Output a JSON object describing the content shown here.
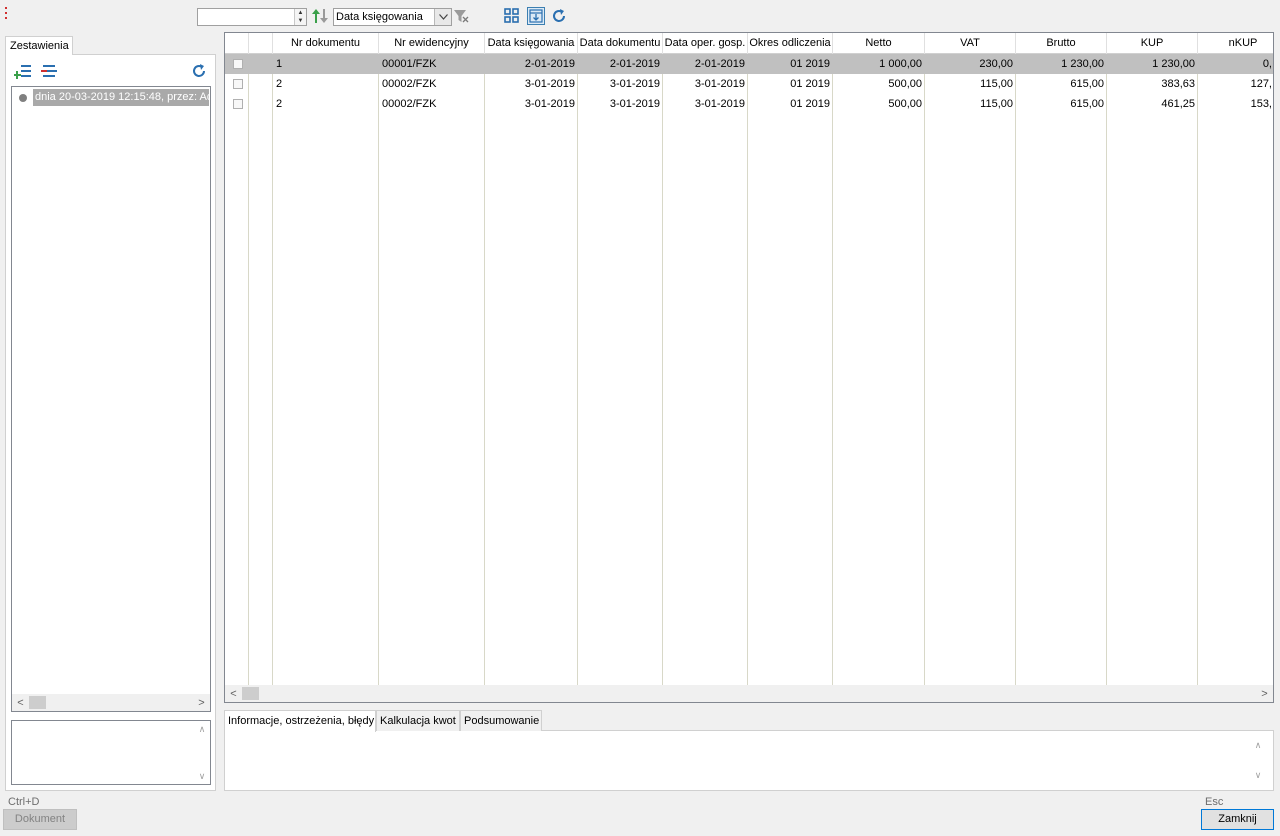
{
  "toolbar": {
    "spin_value": "",
    "sort_field": "Data księgowania"
  },
  "left": {
    "tab_label": "Zestawienia",
    "items": [
      {
        "label": "dnia 20-03-2019 12:15:48, przez: Ad"
      }
    ]
  },
  "grid": {
    "columns": [
      "Nr dokumentu",
      "Nr ewidencyjny",
      "Data księgowania",
      "Data dokumentu",
      "Data oper. gosp.",
      "Okres odliczenia",
      "Netto",
      "VAT",
      "Brutto",
      "KUP",
      "nKUP"
    ],
    "rows": [
      {
        "selected": true,
        "cells": [
          "1",
          "00001/FZK",
          "2-01-2019",
          "2-01-2019",
          "2-01-2019",
          "01 2019",
          "1 000,00",
          "230,00",
          "1 230,00",
          "1 230,00",
          "0,"
        ]
      },
      {
        "selected": false,
        "cells": [
          "2",
          "00002/FZK",
          "3-01-2019",
          "3-01-2019",
          "3-01-2019",
          "01 2019",
          "500,00",
          "115,00",
          "615,00",
          "383,63",
          "127,"
        ]
      },
      {
        "selected": false,
        "cells": [
          "2",
          "00002/FZK",
          "3-01-2019",
          "3-01-2019",
          "3-01-2019",
          "01 2019",
          "500,00",
          "115,00",
          "615,00",
          "461,25",
          "153,"
        ]
      }
    ]
  },
  "bottom_tabs": [
    {
      "label": "Informacje, ostrzeżenia, błędy"
    },
    {
      "label": "Kalkulacja kwot"
    },
    {
      "label": "Podsumowanie"
    }
  ],
  "footer": {
    "dokument_shortcut": "Ctrl+D",
    "dokument_label": "Dokument",
    "close_shortcut": "Esc",
    "close_label": "Zamknij"
  },
  "colors": {
    "accent_blue": "#2a6fb0",
    "accent_green": "#3aa04a",
    "accent_red": "#d03030",
    "selection_gray": "#c0c0c0"
  }
}
